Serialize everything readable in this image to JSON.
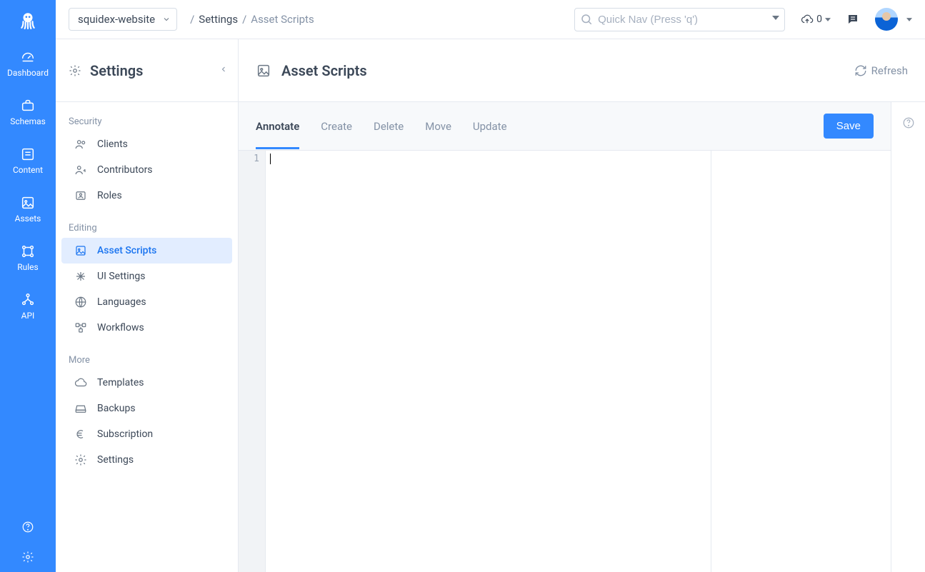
{
  "app_select": {
    "value": "squidex-website"
  },
  "crumbs": {
    "settings": "Settings",
    "page": "Asset Scripts"
  },
  "quicknav": {
    "placeholder": "Quick Nav (Press 'q')"
  },
  "cloud_badge": "0",
  "sidebar": {
    "items": [
      {
        "id": "dashboard",
        "label": "Dashboard"
      },
      {
        "id": "schemas",
        "label": "Schemas"
      },
      {
        "id": "content",
        "label": "Content"
      },
      {
        "id": "assets",
        "label": "Assets"
      },
      {
        "id": "rules",
        "label": "Rules"
      },
      {
        "id": "api",
        "label": "API"
      }
    ]
  },
  "panel": {
    "title": "Settings",
    "sections": {
      "security": {
        "label": "Security",
        "items": [
          {
            "id": "clients",
            "label": "Clients"
          },
          {
            "id": "contributors",
            "label": "Contributors"
          },
          {
            "id": "roles",
            "label": "Roles"
          }
        ]
      },
      "editing": {
        "label": "Editing",
        "items": [
          {
            "id": "asset-scripts",
            "label": "Asset Scripts",
            "active": true
          },
          {
            "id": "ui-settings",
            "label": "UI Settings"
          },
          {
            "id": "languages",
            "label": "Languages"
          },
          {
            "id": "workflows",
            "label": "Workflows"
          }
        ]
      },
      "more": {
        "label": "More",
        "items": [
          {
            "id": "templates",
            "label": "Templates"
          },
          {
            "id": "backups",
            "label": "Backups"
          },
          {
            "id": "subscription",
            "label": "Subscription"
          },
          {
            "id": "settings",
            "label": "Settings"
          }
        ]
      }
    }
  },
  "page": {
    "title": "Asset Scripts",
    "refresh_label": "Refresh",
    "save_label": "Save",
    "tabs": [
      {
        "id": "annotate",
        "label": "Annotate",
        "active": true
      },
      {
        "id": "create",
        "label": "Create"
      },
      {
        "id": "delete",
        "label": "Delete"
      },
      {
        "id": "move",
        "label": "Move"
      },
      {
        "id": "update",
        "label": "Update"
      }
    ],
    "editor": {
      "line_number": "1",
      "content": ""
    }
  }
}
